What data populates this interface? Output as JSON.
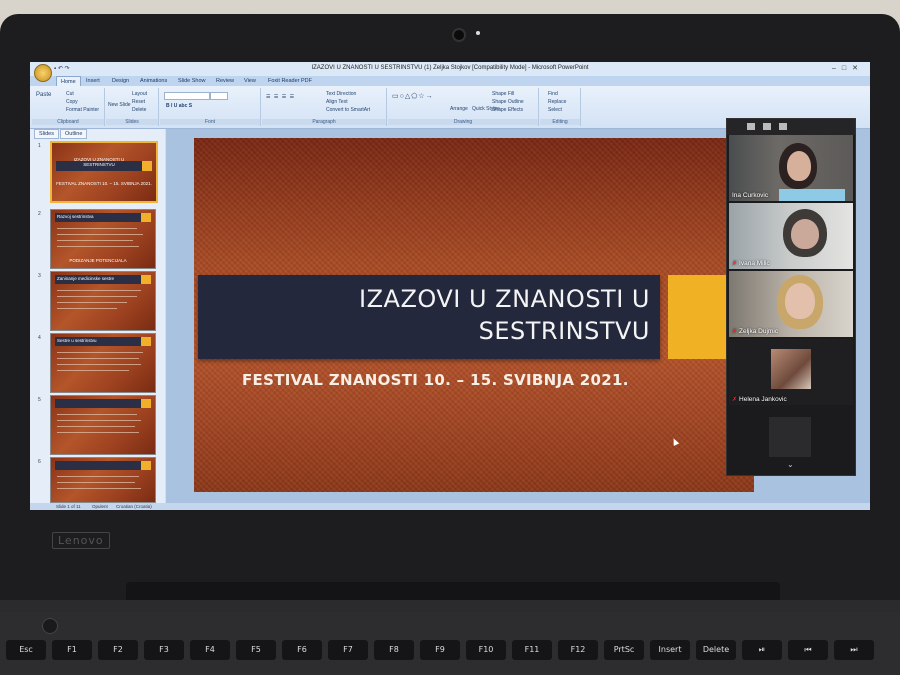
{
  "window": {
    "title": "IZAZOVI U ZNANOSTI U SESTRINSTVU (1) Zeljka Stojkov [Compatibility Mode] - Microsoft PowerPoint",
    "controls": [
      "–",
      "□",
      "✕"
    ]
  },
  "ribbon": {
    "tabs": [
      "Home",
      "Insert",
      "Design",
      "Animations",
      "Slide Show",
      "Review",
      "View",
      "Foxit Reader PDF"
    ],
    "active_tab": "Home",
    "groups": {
      "clipboard": {
        "label": "Clipboard",
        "items": [
          "Paste",
          "Cut",
          "Copy",
          "Format Painter"
        ]
      },
      "slides": {
        "label": "Slides",
        "items": [
          "New Slide",
          "Layout",
          "Reset",
          "Delete"
        ]
      },
      "font": {
        "label": "Font"
      },
      "paragraph": {
        "label": "Paragraph",
        "items": [
          "Text Direction",
          "Align Text",
          "Convert to SmartArt"
        ]
      },
      "drawing": {
        "label": "Drawing",
        "items": [
          "Arrange",
          "Quick Styles",
          "Shape Fill",
          "Shape Outline",
          "Shape Effects"
        ]
      },
      "editing": {
        "label": "Editing",
        "items": [
          "Find",
          "Replace",
          "Select"
        ]
      }
    }
  },
  "slides_pane": {
    "tabs": [
      "Slides",
      "Outline"
    ],
    "thumbnails": [
      {
        "num": "1",
        "title": "IZAZOVI U ZNANOSTI U SESTRINSTVU",
        "subtitle": "FESTIVAL ZNANOSTI 10. – 15. SVIBNJA 2021."
      },
      {
        "num": "2",
        "title": "Razvoj sestrinstva",
        "footer": "PODIZANJE POTENCIJALA"
      },
      {
        "num": "3",
        "title": "Zaninanje medicinske sestre"
      },
      {
        "num": "4",
        "title": "Sestre u sestrinstvu"
      },
      {
        "num": "5",
        "title": ""
      },
      {
        "num": "6",
        "title": ""
      }
    ]
  },
  "slide": {
    "title_line1": "IZAZOVI U ZNANOSTI U",
    "title_line2": "SESTRINSTVU",
    "subtitle": "FESTIVAL ZNANOSTI 10. – 15. SVIBNJA 2021.",
    "colors": {
      "band": "#23283c",
      "accent": "#f1b125",
      "background": "#a84a23"
    }
  },
  "statusbar": {
    "slide_info": "Slide 1 of 11",
    "theme": "Opulent",
    "language": "Croatian (Croatia)"
  },
  "zoom": {
    "participants": [
      {
        "name": "Ina Curkovic",
        "muted": false
      },
      {
        "name": "Ivana Milic",
        "muted": true
      },
      {
        "name": "Zeljka Dujmic",
        "muted": true
      },
      {
        "name": "Helena Jankovic",
        "muted": true
      }
    ],
    "more_icon": "chevron-down-icon"
  },
  "laptop": {
    "brand": "Lenovo",
    "keys": [
      "Esc",
      "F1",
      "F2",
      "F3",
      "F4",
      "F5",
      "F6",
      "F7",
      "F8",
      "F9",
      "F10",
      "F11",
      "F12",
      "PrtSc",
      "Insert",
      "Delete",
      "⏯",
      "⏮",
      "⏭"
    ]
  }
}
